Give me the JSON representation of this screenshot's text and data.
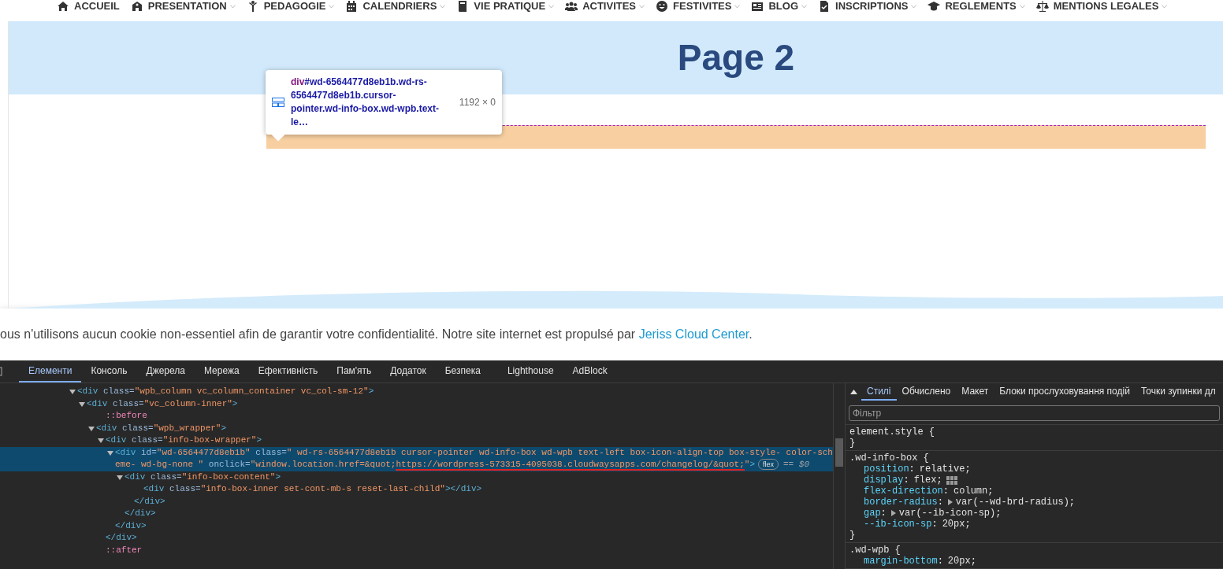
{
  "nav": [
    {
      "label": "ACCUEIL",
      "has_submenu": false
    },
    {
      "label": "PRESENTATION",
      "has_submenu": true
    },
    {
      "label": "PEDAGOGIE",
      "has_submenu": true
    },
    {
      "label": "CALENDRIERS",
      "has_submenu": true
    },
    {
      "label": "VIE PRATIQUE",
      "has_submenu": true
    },
    {
      "label": "ACTIVITES",
      "has_submenu": true
    },
    {
      "label": "FESTIVITES",
      "has_submenu": true
    },
    {
      "label": "BLOG",
      "has_submenu": true
    },
    {
      "label": "INSCRIPTIONS",
      "has_submenu": true
    },
    {
      "label": "REGLEMENTS",
      "has_submenu": true
    },
    {
      "label": "MENTIONS LEGALES",
      "has_submenu": true
    }
  ],
  "page_title": "Page 2",
  "inspect_tooltip": {
    "tag": "div",
    "selector": "#wd-6564477d8eb1b.wd-rs-6564477d8eb1b.cursor-pointer.wd-info-box.wd-wpb.text-le…",
    "size": "1192 × 0"
  },
  "cookie_notice": {
    "text_before": "ous n'utilisons aucun cookie non-essentiel afin de garantir votre confidentialité. Notre site internet est propulsé par ",
    "link": "Jeriss Cloud Center",
    "text_after": "."
  },
  "devtools": {
    "tabs": [
      {
        "label": "Елементи",
        "selected": true
      },
      {
        "label": "Консоль",
        "selected": false
      },
      {
        "label": "Джерела",
        "selected": false
      },
      {
        "label": "Мережа",
        "selected": false
      },
      {
        "label": "Ефективність",
        "selected": false
      },
      {
        "label": "Пам'ять",
        "selected": false
      },
      {
        "label": "Додаток",
        "selected": false
      },
      {
        "label": "Безпека",
        "selected": false
      },
      {
        "label": "Lighthouse",
        "selected": false
      },
      {
        "label": "AdBlock",
        "selected": false
      }
    ],
    "dom_tree": [
      {
        "expanded": true,
        "selected": false,
        "open": [
          {
            "kind": "tag",
            "text": "<div"
          },
          {
            "kind": "attr",
            "text": " class="
          },
          {
            "kind": "value",
            "text": "\"wpb_column vc_column_container vc_col-sm-12\""
          },
          {
            "kind": "tag",
            "text": ">"
          }
        ],
        "children": [
          {
            "expanded": true,
            "selected": false,
            "open": [
              {
                "kind": "tag",
                "text": "<div"
              },
              {
                "kind": "attr",
                "text": " class="
              },
              {
                "kind": "value",
                "text": "\"vc_column-inner\""
              },
              {
                "kind": "tag",
                "text": ">"
              }
            ],
            "children": [
              {
                "selected": false,
                "open": [
                  {
                    "kind": "pseudo",
                    "text": "::before"
                  }
                ]
              },
              {
                "expanded": true,
                "selected": false,
                "open": [
                  {
                    "kind": "tag",
                    "text": "<div"
                  },
                  {
                    "kind": "attr",
                    "text": " class="
                  },
                  {
                    "kind": "value",
                    "text": "\"wpb_wrapper\""
                  },
                  {
                    "kind": "tag",
                    "text": ">"
                  }
                ],
                "children": [
                  {
                    "expanded": true,
                    "selected": false,
                    "open": [
                      {
                        "kind": "tag",
                        "text": "<div"
                      },
                      {
                        "kind": "attr",
                        "text": " class="
                      },
                      {
                        "kind": "value",
                        "text": "\"info-box-wrapper\""
                      },
                      {
                        "kind": "tag",
                        "text": ">"
                      }
                    ],
                    "children": [
                      {
                        "expanded": true,
                        "selected": true,
                        "badge": "flex",
                        "console_ref": "== $0",
                        "open": [
                          {
                            "kind": "tag",
                            "text": "<div"
                          },
                          {
                            "kind": "attr",
                            "text": " id="
                          },
                          {
                            "kind": "value",
                            "text": "\"wd-6564477d8eb1b\""
                          },
                          {
                            "kind": "attr",
                            "text": " class="
                          },
                          {
                            "kind": "value",
                            "text": "\" wd-rs-6564477d8eb1b cursor-pointer wd-info-box wd-wpb text-left box-icon-align-top box-style- color-scheme- wd-bg-none \""
                          },
                          {
                            "kind": "attr",
                            "text": " onclick="
                          },
                          {
                            "kind": "value",
                            "text": "\"window.location.href=&quot;"
                          },
                          {
                            "kind": "value",
                            "text": "https://wordpress-573315-4095038.cloudwaysapps.com/changelog/&quot;",
                            "underlined": true
                          },
                          {
                            "kind": "value",
                            "text": "\""
                          },
                          {
                            "kind": "tag",
                            "text": ">"
                          }
                        ],
                        "children": [
                          {
                            "expanded": true,
                            "selected": false,
                            "open": [
                              {
                                "kind": "tag",
                                "text": "<div"
                              },
                              {
                                "kind": "attr",
                                "text": " class="
                              },
                              {
                                "kind": "value",
                                "text": "\"info-box-content\""
                              },
                              {
                                "kind": "tag",
                                "text": ">"
                              }
                            ],
                            "children": [
                              {
                                "selected": false,
                                "open": [
                                  {
                                    "kind": "tag",
                                    "text": "<div"
                                  },
                                  {
                                    "kind": "attr",
                                    "text": " class="
                                  },
                                  {
                                    "kind": "value",
                                    "text": "\"info-box-inner set-cont-mb-s reset-last-child\""
                                  },
                                  {
                                    "kind": "tag",
                                    "text": "></div>"
                                  }
                                ]
                              }
                            ],
                            "close": "</div>"
                          }
                        ],
                        "close": "</div>"
                      }
                    ],
                    "close": "</div>"
                  }
                ],
                "close": "</div>"
              },
              {
                "selected": false,
                "open": [
                  {
                    "kind": "pseudo",
                    "text": "::after"
                  }
                ]
              }
            ]
          }
        ]
      }
    ],
    "side_tabs": [
      {
        "label": "Стилі",
        "selected": true
      },
      {
        "label": "Обчислено",
        "selected": false
      },
      {
        "label": "Макет",
        "selected": false
      },
      {
        "label": "Блоки прослуховування подій",
        "selected": false
      },
      {
        "label": "Точки зупинки дл",
        "selected": false
      }
    ],
    "filter": {
      "placeholder": "Фільтр"
    },
    "rules": [
      {
        "selector": "element.style",
        "open": "{",
        "close": "}"
      },
      {
        "selector": ".wd-info-box",
        "open": "{",
        "close": "}",
        "properties": [
          {
            "name": "position",
            "colon": ":",
            "value": "relative;",
            "expandable": false,
            "flex_editor": false
          },
          {
            "name": "display",
            "colon": ":",
            "value": "flex;",
            "expandable": false,
            "flex_editor": true
          },
          {
            "name": "flex-direction",
            "colon": ":",
            "value": "column;",
            "expandable": false,
            "flex_editor": false
          },
          {
            "name": "border-radius",
            "colon": ":",
            "value": "var(--wd-brd-radius);",
            "expandable": true,
            "flex_editor": false
          },
          {
            "name": "gap",
            "colon": ":",
            "value": "var(--ib-icon-sp);",
            "expandable": true,
            "flex_editor": false
          },
          {
            "name": "--ib-icon-sp",
            "colon": ":",
            "value": "20px;",
            "expandable": false,
            "flex_editor": false
          }
        ]
      },
      {
        "selector": ".wd-wpb",
        "open": "{",
        "properties": [
          {
            "name": "margin-bottom",
            "colon": ":",
            "value": "20px;",
            "expandable": false,
            "flex_editor": false
          }
        ]
      }
    ]
  }
}
